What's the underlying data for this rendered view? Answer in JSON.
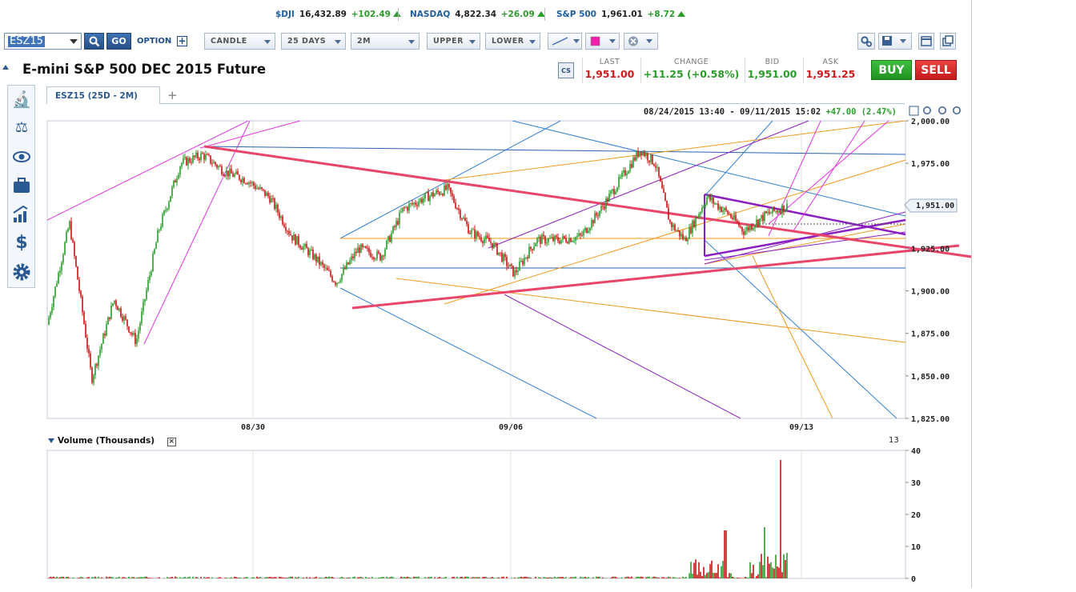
{
  "tickers": [
    {
      "name": "$DJI",
      "value": "16,432.89",
      "change": "+102.49"
    },
    {
      "name": "NASDAQ",
      "value": "4,822.34",
      "change": "+26.09"
    },
    {
      "name": "S&P 500",
      "value": "1,961.01",
      "change": "+8.72"
    }
  ],
  "toolbar": {
    "symbol": "ESZ15",
    "go_label": "GO",
    "option_label": "OPTION",
    "chart_type": "CANDLE",
    "period": "25 DAYS",
    "interval": "2M",
    "upper": "UPPER",
    "lower": "LOWER"
  },
  "instrument": {
    "title": "E-mini S&P 500 DEC 2015 Future"
  },
  "quote": {
    "last_label": "LAST",
    "last": "1,951.00",
    "change_label": "CHANGE",
    "change": "+11.25 (+0.58%)",
    "bid_label": "BID",
    "bid": "1,951.00",
    "ask_label": "ASK",
    "ask": "1,951.25",
    "buy_label": "BUY",
    "sell_label": "SELL"
  },
  "tabs": [
    {
      "label": "ESZ15 (25D - 2M)"
    }
  ],
  "chart": {
    "range_text": "08/24/2015 13:40 - 09/11/2015 15:02",
    "range_change": "+47.00 (2.47%)",
    "price_ticks": [
      "2,000.00",
      "1,975.00",
      "1,951.00",
      "1,925.00",
      "1,900.00",
      "1,875.00",
      "1,850.00",
      "1,825.00"
    ],
    "date_ticks": [
      "08/30",
      "09/06",
      "09/13"
    ],
    "last_price_tag": "1,951.00"
  },
  "volume": {
    "title": "Volume (Thousands)",
    "ticks": [
      "40",
      "30",
      "20",
      "10",
      "0"
    ],
    "last_label": "13"
  },
  "colors": {
    "up": "#2a9d2a",
    "down": "#c81414",
    "accent": "#1e5fa0",
    "trend": "#e8456a"
  },
  "chart_data": {
    "type": "candlestick",
    "ylim": [
      1825,
      2000
    ],
    "x_ticks": [
      "08/30",
      "09/06",
      "09/13"
    ],
    "close_path": [
      [
        0,
        1880
      ],
      [
        3,
        1940
      ],
      [
        5,
        1880
      ],
      [
        6,
        1848
      ],
      [
        9,
        1895
      ],
      [
        12,
        1870
      ],
      [
        15,
        1935
      ],
      [
        18,
        1975
      ],
      [
        21,
        1980
      ],
      [
        24,
        1970
      ],
      [
        27,
        1965
      ],
      [
        30,
        1955
      ],
      [
        33,
        1932
      ],
      [
        36,
        1920
      ],
      [
        39,
        1905
      ],
      [
        42,
        1925
      ],
      [
        45,
        1920
      ],
      [
        48,
        1948
      ],
      [
        51,
        1955
      ],
      [
        54,
        1960
      ],
      [
        57,
        1935
      ],
      [
        60,
        1928
      ],
      [
        63,
        1910
      ],
      [
        66,
        1930
      ],
      [
        69,
        1930
      ],
      [
        72,
        1932
      ],
      [
        75,
        1950
      ],
      [
        78,
        1970
      ],
      [
        80,
        1983
      ],
      [
        82,
        1975
      ],
      [
        84,
        1940
      ],
      [
        86,
        1930
      ],
      [
        89,
        1955
      ],
      [
        92,
        1945
      ],
      [
        94,
        1935
      ],
      [
        97,
        1945
      ],
      [
        100,
        1950
      ]
    ]
  }
}
